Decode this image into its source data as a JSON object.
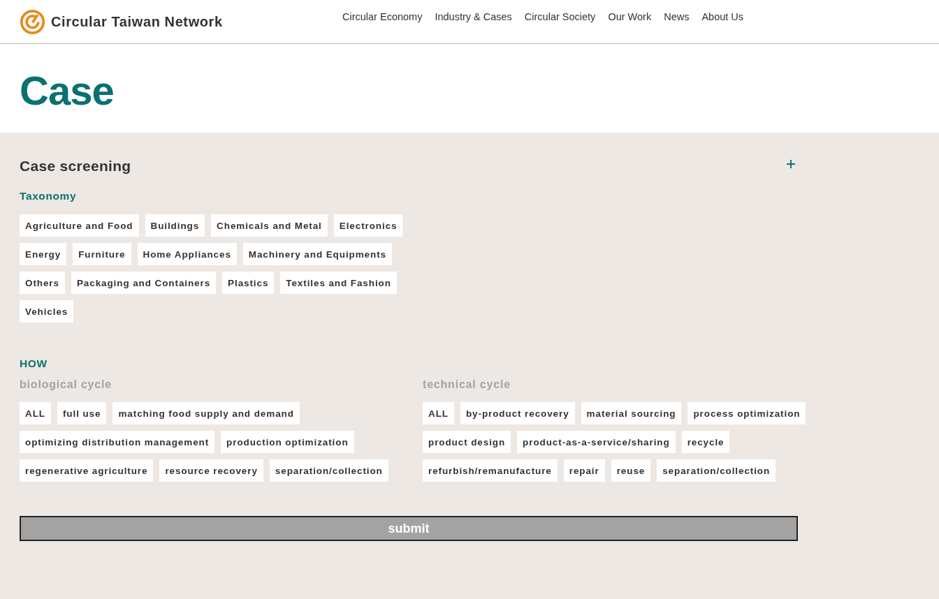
{
  "header": {
    "logo_text": "Circular Taiwan Network",
    "nav": [
      "Circular Economy",
      "Industry & Cases",
      "Circular Society",
      "Our Work",
      "News",
      "About Us"
    ]
  },
  "page_title": "Case",
  "screening": {
    "title": "Case screening",
    "expanded": false,
    "taxonomy": {
      "label": "Taxonomy",
      "tags": [
        {
          "label": "Agriculture and Food",
          "selected": false
        },
        {
          "label": "Buildings",
          "selected": false
        },
        {
          "label": "Chemicals and Metal",
          "selected": false
        },
        {
          "label": "Electronics",
          "selected": false
        },
        {
          "label": "Energy",
          "selected": false
        },
        {
          "label": "Furniture",
          "selected": false
        },
        {
          "label": "Home Appliances",
          "selected": false
        },
        {
          "label": "Machinery and Equipments",
          "selected": false
        },
        {
          "label": "Others",
          "selected": false
        },
        {
          "label": "Packaging and Containers",
          "selected": false
        },
        {
          "label": "Plastics",
          "selected": false
        },
        {
          "label": "Textiles and Fashion",
          "selected": false
        },
        {
          "label": "Vehicles",
          "selected": false
        }
      ]
    },
    "how": {
      "label": "HOW",
      "groups": [
        {
          "label": "biological cycle",
          "tags": [
            {
              "label": "ALL",
              "selected": false
            },
            {
              "label": "full use",
              "selected": false
            },
            {
              "label": "matching food supply and demand",
              "selected": false
            },
            {
              "label": "optimizing distribution management",
              "selected": false
            },
            {
              "label": "production optimization",
              "selected": false
            },
            {
              "label": "regenerative agriculture",
              "selected": false
            },
            {
              "label": "resource recovery",
              "selected": false
            },
            {
              "label": "separation/collection",
              "selected": false
            }
          ]
        },
        {
          "label": "technical cycle",
          "tags": [
            {
              "label": "ALL",
              "selected": false
            },
            {
              "label": "by-product recovery",
              "selected": false
            },
            {
              "label": "material sourcing",
              "selected": false
            },
            {
              "label": "process optimization",
              "selected": false
            },
            {
              "label": "product design",
              "selected": false
            },
            {
              "label": "product-as-a-service/sharing",
              "selected": false
            },
            {
              "label": "recycle",
              "selected": false
            },
            {
              "label": "refurbish/remanufacture",
              "selected": false
            },
            {
              "label": "repair",
              "selected": false
            },
            {
              "label": "reuse",
              "selected": false
            },
            {
              "label": "separation/collection",
              "selected": false
            }
          ]
        }
      ]
    },
    "submit": "submit"
  }
}
